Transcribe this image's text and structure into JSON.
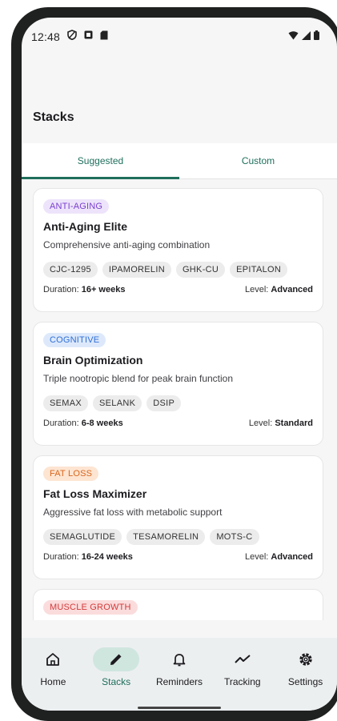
{
  "status_bar": {
    "time": "12:48",
    "left_icons": [
      "vpn-shield-icon",
      "notification-icon",
      "sd-card-icon"
    ],
    "right_icons": [
      "wifi-icon",
      "signal-icon",
      "battery-icon"
    ]
  },
  "page": {
    "title": "Stacks"
  },
  "tabs": [
    {
      "label": "Suggested",
      "active": true
    },
    {
      "label": "Custom",
      "active": false
    }
  ],
  "stacks": [
    {
      "category": "ANTI-AGING",
      "category_color": "#7a3fd0",
      "title": "Anti-Aging Elite",
      "description": "Comprehensive anti-aging combination",
      "peptides": [
        "CJC-1295",
        "IPAMORELIN",
        "GHK-CU",
        "EPITALON"
      ],
      "duration_label": "Duration:",
      "duration": "16+ weeks",
      "level_label": "Level:",
      "level": "Advanced"
    },
    {
      "category": "COGNITIVE",
      "category_color": "#2f6fd6",
      "title": "Brain Optimization",
      "description": "Triple nootropic blend for peak brain function",
      "peptides": [
        "SEMAX",
        "SELANK",
        "DSIP"
      ],
      "duration_label": "Duration:",
      "duration": "6-8 weeks",
      "level_label": "Level:",
      "level": "Standard"
    },
    {
      "category": "FAT LOSS",
      "category_color": "#d9661d",
      "title": "Fat Loss Maximizer",
      "description": "Aggressive fat loss with metabolic support",
      "peptides": [
        "SEMAGLUTIDE",
        "TESAMORELIN",
        "MOTS-C"
      ],
      "duration_label": "Duration:",
      "duration": "16-24 weeks",
      "level_label": "Level:",
      "level": "Advanced"
    },
    {
      "category": "MUSCLE GROWTH",
      "category_color": "#d33b3b"
    }
  ],
  "bottom_nav": [
    {
      "label": "Home",
      "icon": "home-icon",
      "active": false
    },
    {
      "label": "Stacks",
      "icon": "pencil-icon",
      "active": true
    },
    {
      "label": "Reminders",
      "icon": "bell-icon",
      "active": false
    },
    {
      "label": "Tracking",
      "icon": "trend-icon",
      "active": false
    },
    {
      "label": "Settings",
      "icon": "gear-icon",
      "active": false
    }
  ]
}
